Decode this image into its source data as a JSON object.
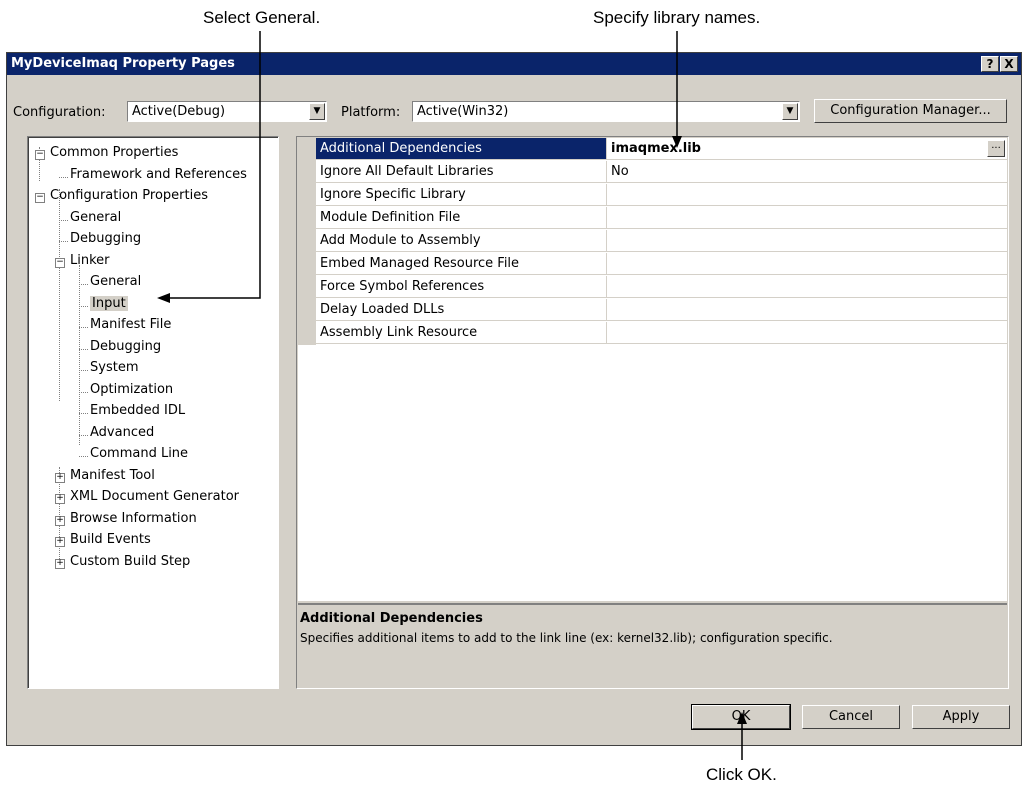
{
  "callouts": {
    "select_general": "Select General.",
    "specify_library": "Specify library names.",
    "click_ok": "Click OK."
  },
  "dialog": {
    "title": "MyDeviceImaq Property Pages",
    "help_label": "?",
    "close_label": "X"
  },
  "config": {
    "configuration_label": "Configuration:",
    "configuration_value": "Active(Debug)",
    "platform_label": "Platform:",
    "platform_value": "Active(Win32)",
    "manager_button": "Configuration Manager..."
  },
  "tree": {
    "items": [
      {
        "label": "Common Properties",
        "expander": "−"
      },
      {
        "label": "Framework and References"
      },
      {
        "label": "Configuration Properties",
        "expander": "−"
      },
      {
        "label": "General"
      },
      {
        "label": "Debugging"
      },
      {
        "label": "Linker",
        "expander": "−"
      },
      {
        "label": "General"
      },
      {
        "label": "Input"
      },
      {
        "label": "Manifest File"
      },
      {
        "label": "Debugging"
      },
      {
        "label": "System"
      },
      {
        "label": "Optimization"
      },
      {
        "label": "Embedded IDL"
      },
      {
        "label": "Advanced"
      },
      {
        "label": "Command Line"
      },
      {
        "label": "Manifest Tool",
        "expander": "+"
      },
      {
        "label": "XML Document Generator",
        "expander": "+"
      },
      {
        "label": "Browse Information",
        "expander": "+"
      },
      {
        "label": "Build Events",
        "expander": "+"
      },
      {
        "label": "Custom Build Step",
        "expander": "+"
      }
    ]
  },
  "properties": {
    "rows": [
      {
        "name": "Additional Dependencies",
        "value": "imaqmex.lib"
      },
      {
        "name": "Ignore All Default Libraries",
        "value": "No"
      },
      {
        "name": "Ignore Specific Library",
        "value": ""
      },
      {
        "name": "Module Definition File",
        "value": ""
      },
      {
        "name": "Add Module to Assembly",
        "value": ""
      },
      {
        "name": "Embed Managed Resource File",
        "value": ""
      },
      {
        "name": "Force Symbol References",
        "value": ""
      },
      {
        "name": "Delay Loaded DLLs",
        "value": ""
      },
      {
        "name": "Assembly Link Resource",
        "value": ""
      }
    ],
    "ellipsis_label": "...",
    "description_title": "Additional Dependencies",
    "description_text": "Specifies additional items to add to the link line (ex: kernel32.lib); configuration specific."
  },
  "buttons": {
    "ok": "OK",
    "cancel": "Cancel",
    "apply": "Apply"
  },
  "colors": {
    "titlebar": "#0a246a",
    "dialog_face": "#d4d0c8",
    "selection": "#0a246a"
  }
}
